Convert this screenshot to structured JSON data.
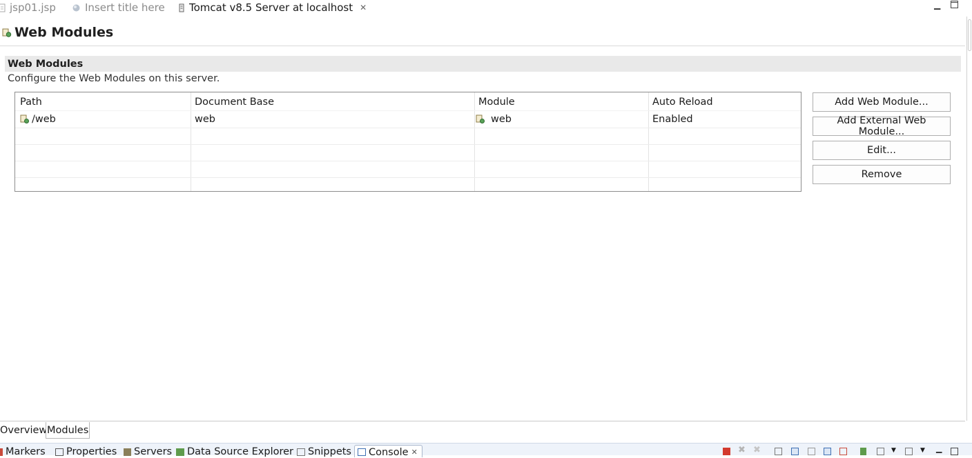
{
  "editor_tabs": [
    {
      "label": "jsp01.jsp",
      "icon": "jsp-file-icon",
      "active": false
    },
    {
      "label": "Insert title here",
      "icon": "browser-globe-icon",
      "active": false
    },
    {
      "label": "Tomcat v8.5 Server at localhost",
      "icon": "server-config-icon",
      "active": true
    }
  ],
  "page": {
    "title": "Web Modules",
    "icon": "web-modules-icon"
  },
  "section": {
    "title": "Web Modules",
    "description": "Configure the Web Modules on this server."
  },
  "table": {
    "columns": [
      "Path",
      "Document Base",
      "Module",
      "Auto Reload"
    ],
    "rows": [
      {
        "path": "/web",
        "document_base": "web",
        "module": "web",
        "auto_reload": "Enabled"
      }
    ]
  },
  "buttons": {
    "add_web_module": "Add Web Module...",
    "add_external_web_module": "Add External Web Module...",
    "edit": "Edit...",
    "remove": "Remove"
  },
  "form_tabs": [
    "Overview",
    "Modules"
  ],
  "view_tabs": [
    "Markers",
    "Properties",
    "Servers",
    "Data Source Explorer",
    "Snippets",
    "Console"
  ],
  "colors": {
    "accent_blue": "#3d6fb3",
    "terminate_red": "#d33a2e",
    "section_bg": "#e9e9e9"
  }
}
